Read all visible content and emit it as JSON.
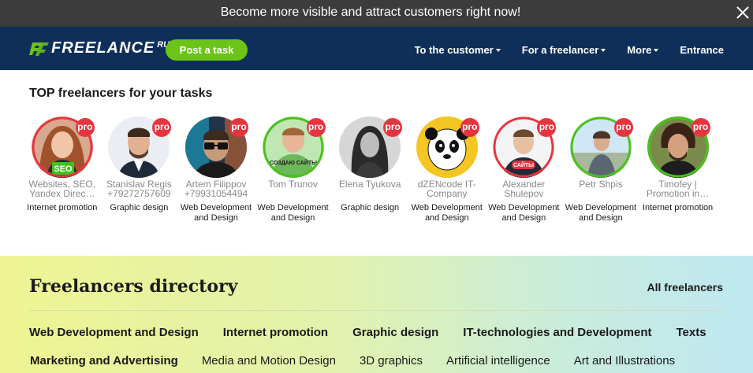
{
  "banner": {
    "text": "Become more visible and attract customers right now!"
  },
  "header": {
    "logo_text": "FREELANCE",
    "logo_suffix": "RU",
    "post_task": "Post a task",
    "nav": [
      {
        "label": "To the customer"
      },
      {
        "label": "For a freelancer"
      },
      {
        "label": "More"
      },
      {
        "label": "Entrance"
      }
    ]
  },
  "top": {
    "title": "TOP freelancers for your tasks",
    "freelancers": [
      {
        "name": "Websites, SEO, Yandex Direc…",
        "spec": "Internet promotion",
        "pro": "pro",
        "ring": "#e8343f",
        "avatar_label": "SEO"
      },
      {
        "name": "Stanislav Regis +79272757609",
        "spec": "Graphic design",
        "pro": "pro",
        "ring": "",
        "avatar_label": ""
      },
      {
        "name": "Artem Filippov +79931054494",
        "spec": "Web Development and Design",
        "pro": "pro",
        "ring": "",
        "avatar_label": ""
      },
      {
        "name": "Tom Trunov",
        "spec": "Web Development and Design",
        "pro": "pro",
        "ring": "#49c21c",
        "avatar_label": "СОЗДАЮ САЙТЫ"
      },
      {
        "name": "Elena Tyukova",
        "spec": "Graphic design",
        "pro": "pro",
        "ring": "",
        "avatar_label": ""
      },
      {
        "name": "dZENcode IT-Company",
        "spec": "Web Development and Design",
        "pro": "pro",
        "ring": "#f3c623",
        "avatar_label": ""
      },
      {
        "name": "Alexander Shulepov",
        "spec": "Web Development and Design",
        "pro": "pro",
        "ring": "#e8343f",
        "avatar_label": "САЙТЫ"
      },
      {
        "name": "Petr Shpis",
        "spec": "Web Development and Design",
        "pro": "pro",
        "ring": "#49c21c",
        "avatar_label": ""
      },
      {
        "name": "Timofey | Promotion in…",
        "spec": "Internet promotion",
        "pro": "pro",
        "ring": "#49c21c",
        "avatar_label": ""
      }
    ]
  },
  "directory": {
    "title": "Freelancers directory",
    "all_link": "All freelancers",
    "categories_row1": [
      "Web Development and Design",
      "Internet promotion",
      "Graphic design",
      "IT-technologies and Development",
      "Texts"
    ],
    "categories_row2": [
      "Marketing and Advertising",
      "Media and Motion Design",
      "3D graphics",
      "Artificial intelligence",
      "Art and Illustrations"
    ]
  },
  "colors": {
    "header_bg": "#0f2f5a",
    "banner_bg": "#3c3c3c",
    "accent_green": "#6cc418",
    "pro_red": "#e8343f"
  }
}
